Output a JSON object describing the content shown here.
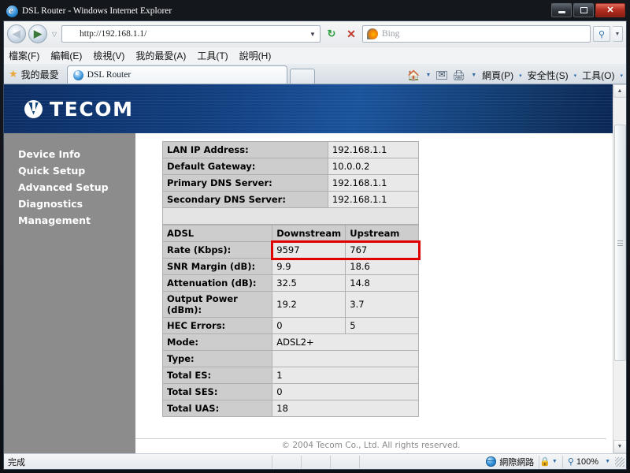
{
  "window": {
    "title": "DSL Router - Windows Internet Explorer",
    "ie_icon": "internet-explorer-icon",
    "minimize_label": "",
    "maximize_label": "",
    "close_label": "✕"
  },
  "navigation": {
    "back_glyph": "◀",
    "forward_glyph": "▶",
    "recent_glyph": "▽",
    "address_icon": "internet-explorer-icon",
    "address_value": "http://192.168.1.1/",
    "address_dropdown_glyph": "▼",
    "refresh_glyph": "↻",
    "stop_glyph": "✕",
    "search_icon": "bing-icon",
    "search_placeholder": "Bing",
    "search_go_glyph": "🔍",
    "search_dropdown_glyph": "▼"
  },
  "menubar": {
    "items": [
      {
        "label": "檔案(F)",
        "name": "menu-file"
      },
      {
        "label": "編輯(E)",
        "name": "menu-edit"
      },
      {
        "label": "檢視(V)",
        "name": "menu-view"
      },
      {
        "label": "我的最愛(A)",
        "name": "menu-favorites"
      },
      {
        "label": "工具(T)",
        "name": "menu-tools"
      },
      {
        "label": "說明(H)",
        "name": "menu-help"
      }
    ]
  },
  "favorites_bar": {
    "star_icon": "star-icon",
    "label": "我的最愛"
  },
  "tabs": {
    "active": {
      "icon": "internet-explorer-icon",
      "label": "DSL Router"
    },
    "new_tab_label": ""
  },
  "command_bar": {
    "home_icon": "home-icon",
    "home_dropdown_glyph": "▼",
    "feeds_icon": "mail-icon",
    "print_icon": "printer-icon",
    "print_dropdown_glyph": "▼",
    "page_menu": "網頁(P)",
    "safety_menu": "安全性(S)",
    "tools_menu": "工具(O)",
    "caret_glyph": "▾"
  },
  "page": {
    "brand": {
      "logo_icon": "tecom-logo-icon",
      "name": "TECOM"
    },
    "sidebar": {
      "items": [
        {
          "label": "Device Info",
          "name": "sidebar-item-device-info"
        },
        {
          "label": "Quick Setup",
          "name": "sidebar-item-quick-setup"
        },
        {
          "label": "Advanced Setup",
          "name": "sidebar-item-advanced-setup"
        },
        {
          "label": "Diagnostics",
          "name": "sidebar-item-diagnostics"
        },
        {
          "label": "Management",
          "name": "sidebar-item-management"
        }
      ]
    },
    "network_table": {
      "rows": [
        {
          "label": "LAN IP Address:",
          "value": "192.168.1.1"
        },
        {
          "label": "Default Gateway:",
          "value": "10.0.0.2"
        },
        {
          "label": "Primary DNS Server:",
          "value": "192.168.1.1"
        },
        {
          "label": "Secondary DNS Server:",
          "value": "192.168.1.1"
        }
      ]
    },
    "adsl_table": {
      "headers": [
        "ADSL",
        "Downstream",
        "Upstream"
      ],
      "rows": [
        {
          "label": "Rate (Kbps):",
          "downstream": "9597",
          "upstream": "767",
          "highlighted": true
        },
        {
          "label": "SNR Margin (dB):",
          "downstream": "9.9",
          "upstream": "18.6",
          "highlighted": false
        },
        {
          "label": "Attenuation (dB):",
          "downstream": "32.5",
          "upstream": "14.8",
          "highlighted": false
        },
        {
          "label": "Output Power (dBm):",
          "downstream": "19.2",
          "upstream": "3.7",
          "highlighted": false
        },
        {
          "label": "HEC Errors:",
          "downstream": "0",
          "upstream": "5",
          "highlighted": false
        },
        {
          "label": "Mode:",
          "downstream": "ADSL2+",
          "upstream": "",
          "highlighted": false
        },
        {
          "label": "Type:",
          "downstream": "",
          "upstream": "",
          "highlighted": false
        },
        {
          "label": "Total ES:",
          "downstream": "1",
          "upstream": "",
          "highlighted": false
        },
        {
          "label": "Total SES:",
          "downstream": "0",
          "upstream": "",
          "highlighted": false
        },
        {
          "label": "Total UAS:",
          "downstream": "18",
          "upstream": "",
          "highlighted": false
        }
      ]
    },
    "footer": "© 2004 Tecom Co., Ltd. All rights reserved.",
    "highlight_color": "#e00000"
  },
  "scrollbar": {
    "up_glyph": "▲",
    "down_glyph": "▼"
  },
  "statusbar": {
    "status_text": "完成",
    "zone_icon": "globe-icon",
    "zone_text": "網際網路",
    "protected_icon": "protected-mode-icon",
    "protected_dropdown_glyph": "▼",
    "zoom_icon": "zoom-icon",
    "zoom_level": "100%",
    "zoom_dropdown_glyph": "▼"
  }
}
